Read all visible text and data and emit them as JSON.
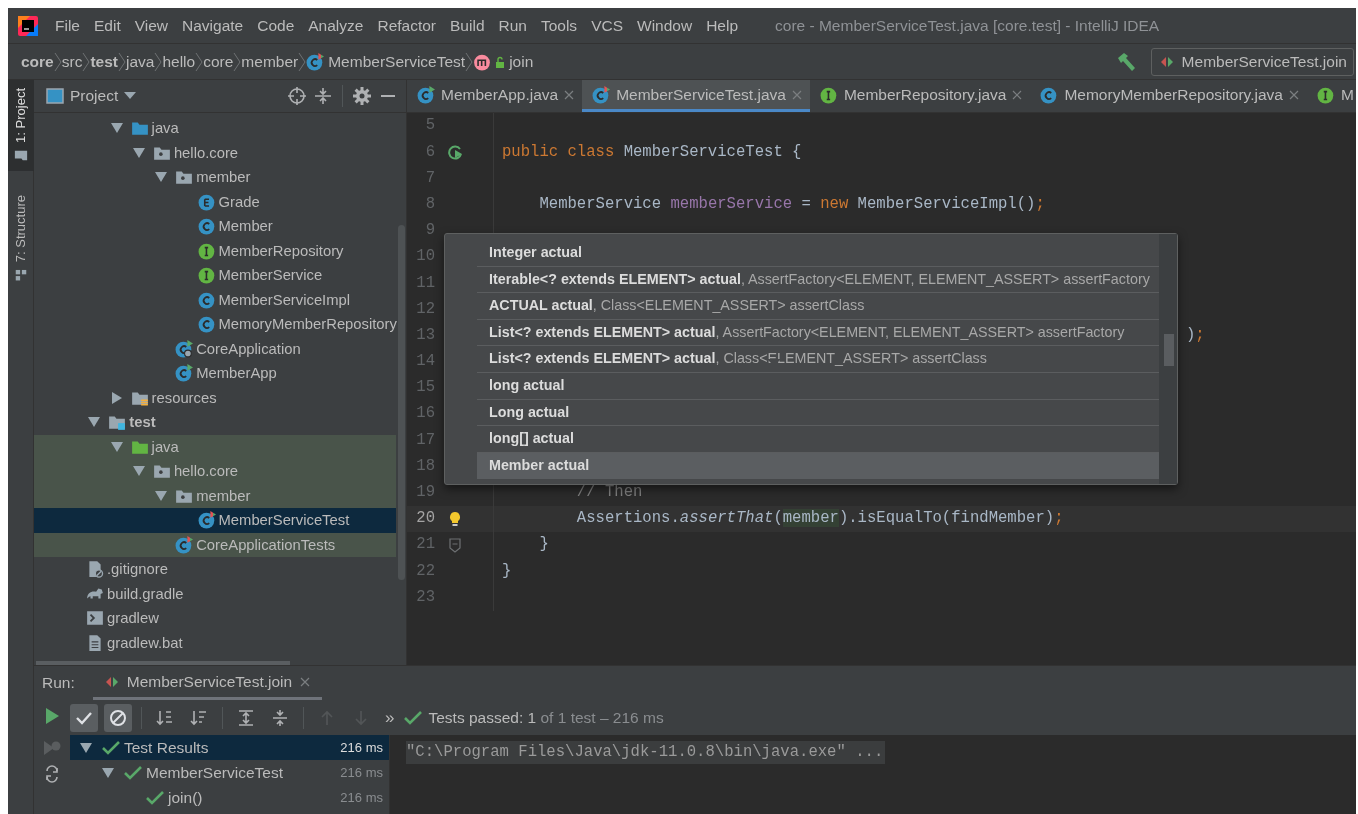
{
  "window": {
    "title": "core - MemberServiceTest.java [core.test] - IntelliJ IDEA"
  },
  "menu": [
    {
      "label": "File"
    },
    {
      "label": "Edit"
    },
    {
      "label": "View"
    },
    {
      "label": "Navigate"
    },
    {
      "label": "Code"
    },
    {
      "label": "Analyze"
    },
    {
      "label": "Refactor"
    },
    {
      "label": "Build"
    },
    {
      "label": "Run"
    },
    {
      "label": "Tools"
    },
    {
      "label": "VCS"
    },
    {
      "label": "Window"
    },
    {
      "label": "Help"
    }
  ],
  "breadcrumbs": [
    {
      "label": "core",
      "bold": true,
      "kind": "plain"
    },
    {
      "label": "src",
      "bold": false,
      "kind": "plain"
    },
    {
      "label": "test",
      "bold": true,
      "kind": "plain"
    },
    {
      "label": "java",
      "bold": false,
      "kind": "plain"
    },
    {
      "label": "hello",
      "bold": false,
      "kind": "plain"
    },
    {
      "label": "core",
      "bold": false,
      "kind": "plain"
    },
    {
      "label": "member",
      "bold": false,
      "kind": "plain"
    },
    {
      "label": "MemberServiceTest",
      "bold": false,
      "kind": "test-class"
    },
    {
      "label": "join",
      "bold": false,
      "kind": "method"
    }
  ],
  "run_config": {
    "label": "MemberServiceTest.join"
  },
  "tool_stripe": [
    {
      "label": "1: Project",
      "selected": true
    },
    {
      "label": "7: Structure",
      "selected": false
    }
  ],
  "project": {
    "title": "Project",
    "tree": [
      {
        "children": [
          {
            "children": [
              {
                "label": "java",
                "kind": "folder-source",
                "expanded": true,
                "selected": false,
                "highlighted": false,
                "bold": false,
                "children": [
                  {
                    "label": "hello.core",
                    "kind": "package",
                    "expanded": true,
                    "selected": false,
                    "highlighted": false,
                    "bold": false,
                    "children": [
                      {
                        "label": "member",
                        "kind": "package",
                        "expanded": true,
                        "selected": false,
                        "highlighted": false,
                        "bold": false,
                        "children": [
                          {
                            "label": "Grade",
                            "kind": "enum",
                            "selected": false,
                            "highlighted": false,
                            "bold": false
                          },
                          {
                            "label": "Member",
                            "kind": "class",
                            "selected": false,
                            "highlighted": false,
                            "bold": false
                          },
                          {
                            "label": "MemberRepository",
                            "kind": "interface",
                            "selected": false,
                            "highlighted": false,
                            "bold": false
                          },
                          {
                            "label": "MemberService",
                            "kind": "interface",
                            "selected": false,
                            "highlighted": false,
                            "bold": false
                          },
                          {
                            "label": "MemberServiceImpl",
                            "kind": "class",
                            "selected": false,
                            "highlighted": false,
                            "bold": false
                          },
                          {
                            "label": "MemoryMemberRepository",
                            "kind": "class",
                            "selected": false,
                            "highlighted": false,
                            "bold": false
                          }
                        ]
                      },
                      {
                        "label": "CoreApplication",
                        "kind": "class-spring",
                        "selected": false,
                        "highlighted": false,
                        "bold": false
                      },
                      {
                        "label": "MemberApp",
                        "kind": "class-run",
                        "selected": false,
                        "highlighted": false,
                        "bold": false
                      }
                    ]
                  }
                ]
              },
              {
                "label": "resources",
                "kind": "folder-resources",
                "expanded": false,
                "selected": false,
                "highlighted": false,
                "bold": false
              }
            ]
          },
          {
            "label": "test",
            "kind": "folder-module",
            "expanded": true,
            "selected": false,
            "highlighted": false,
            "bold": true,
            "children": [
              {
                "label": "java",
                "kind": "folder-test",
                "expanded": true,
                "selected": false,
                "highlighted": true,
                "bold": false,
                "children": [
                  {
                    "label": "hello.core",
                    "kind": "package",
                    "expanded": true,
                    "selected": false,
                    "highlighted": true,
                    "bold": false,
                    "children": [
                      {
                        "label": "member",
                        "kind": "package",
                        "expanded": true,
                        "selected": false,
                        "highlighted": true,
                        "bold": false,
                        "children": [
                          {
                            "label": "MemberServiceTest",
                            "kind": "test-class",
                            "selected": true,
                            "bold": false
                          }
                        ]
                      },
                      {
                        "label": "CoreApplicationTests",
                        "kind": "test-class",
                        "selected": false,
                        "highlighted": true,
                        "bold": false
                      }
                    ]
                  }
                ]
              }
            ]
          }
        ]
      },
      {
        "label": ".gitignore",
        "kind": "ignore-file",
        "selected": false,
        "highlighted": false,
        "bold": false
      },
      {
        "label": "build.gradle",
        "kind": "gradle",
        "selected": false,
        "highlighted": false,
        "bold": false
      },
      {
        "label": "gradlew",
        "kind": "shell",
        "selected": false,
        "highlighted": false,
        "bold": false
      },
      {
        "label": "gradlew.bat",
        "kind": "text-file",
        "selected": false,
        "highlighted": false,
        "bold": false
      }
    ]
  },
  "editor_tabs": [
    {
      "label": "MemberApp.java",
      "kind": "class-run",
      "selected": false,
      "closable": true
    },
    {
      "label": "MemberServiceTest.java",
      "kind": "test-class",
      "selected": true,
      "closable": true
    },
    {
      "label": "MemberRepository.java",
      "kind": "interface",
      "selected": false,
      "closable": true
    },
    {
      "label": "MemoryMemberRepository.java",
      "kind": "class",
      "selected": false,
      "closable": true
    },
    {
      "label": "M",
      "kind": "interface",
      "selected": false,
      "closable": false
    }
  ],
  "editor": {
    "lines": [
      {
        "number": "5",
        "current": false
      },
      {
        "number": "6",
        "current": false,
        "gutter": {
          "kind": "run"
        },
        "tokens": [
          {
            "text": "public class",
            "kind": "keyword"
          },
          {
            "text": " MemberServiceTest {",
            "kind": "plain"
          }
        ]
      },
      {
        "number": "7",
        "current": false
      },
      {
        "number": "8",
        "current": false,
        "tokens": [
          {
            "text": "    MemberService ",
            "kind": "plain"
          },
          {
            "text": "memberService",
            "kind": "field"
          },
          {
            "text": " = ",
            "kind": "plain"
          },
          {
            "text": "new",
            "kind": "keyword"
          },
          {
            "text": " MemberServiceImpl()",
            "kind": "plain"
          },
          {
            "text": ";",
            "kind": "punct"
          }
        ]
      },
      {
        "number": "9",
        "current": false
      },
      {
        "number": "10",
        "current": false
      },
      {
        "number": "11",
        "current": false
      },
      {
        "number": "12",
        "current": false
      },
      {
        "number": "13",
        "current": false,
        "covered": true,
        "tokens": [
          {
            "text": ")",
            "kind": "plain"
          },
          {
            "text": ";",
            "kind": "punct"
          }
        ]
      },
      {
        "number": "14",
        "current": false
      },
      {
        "number": "15",
        "current": false
      },
      {
        "number": "16",
        "current": false
      },
      {
        "number": "17",
        "current": false
      },
      {
        "number": "18",
        "current": false
      },
      {
        "number": "19",
        "current": false,
        "tokens": [
          {
            "text": "        // Then",
            "kind": "comment"
          }
        ]
      },
      {
        "number": "20",
        "current": true,
        "gutter": {
          "kind": "bulb"
        },
        "tokens": [
          {
            "text": "        Assertions.",
            "kind": "plain"
          },
          {
            "text": "assertThat",
            "kind": "italic"
          },
          {
            "text": "(",
            "kind": "plain"
          },
          {
            "text": "member",
            "kind": "match"
          },
          {
            "text": ").isEqualTo(findMember)",
            "kind": "plain"
          },
          {
            "text": ";",
            "kind": "punct"
          }
        ]
      },
      {
        "number": "21",
        "current": false,
        "gutter": {
          "kind": "fold"
        },
        "tokens": [
          {
            "text": "    }",
            "kind": "plain"
          }
        ]
      },
      {
        "number": "22",
        "current": false,
        "tokens": [
          {
            "text": "}",
            "kind": "plain"
          }
        ]
      },
      {
        "number": "23",
        "current": false
      }
    ]
  },
  "completion": {
    "items": [
      {
        "signature": "Integer actual",
        "selected": false
      },
      {
        "signature": "Iterable<? extends ELEMENT> actual",
        "params": ", AssertFactory<ELEMENT, ELEMENT_ASSERT> assertFactory",
        "selected": false
      },
      {
        "signature": "ACTUAL actual",
        "params": ", Class<ELEMENT_ASSERT> assertClass",
        "selected": false
      },
      {
        "signature": "List<? extends ELEMENT> actual",
        "params": ", AssertFactory<ELEMENT, ELEMENT_ASSERT> assertFactory",
        "selected": false
      },
      {
        "signature": "List<? extends ELEMENT> actual",
        "params": ", Class<ELEMENT_ASSERT> assertClass",
        "selected": false
      },
      {
        "signature": "long actual",
        "selected": false
      },
      {
        "signature": "Long actual",
        "selected": false
      },
      {
        "signature": "long[] actual",
        "selected": false
      },
      {
        "signature": "Member actual",
        "selected": true
      }
    ]
  },
  "run": {
    "label": "Run:",
    "tab": {
      "label": "MemberServiceTest.join"
    },
    "toolbar": {
      "show_passed": true,
      "show_ignored": true,
      "navigation_enabled": false,
      "more": "»"
    },
    "status": {
      "summary": "Tests passed: 1",
      "detail": "of 1 test – 216 ms"
    },
    "results": [
      {
        "label": "Test Results",
        "time": "216 ms",
        "selected": true,
        "expanded": true,
        "children": [
          {
            "label": "MemberServiceTest",
            "time": "216 ms",
            "selected": false,
            "expanded": true,
            "children": [
              {
                "label": "join()",
                "time": "216 ms",
                "selected": false
              }
            ]
          }
        ]
      }
    ],
    "console": {
      "lines": [
        "\"C:\\Program Files\\Java\\jdk-11.0.8\\bin\\java.exe\" ..."
      ]
    }
  }
}
